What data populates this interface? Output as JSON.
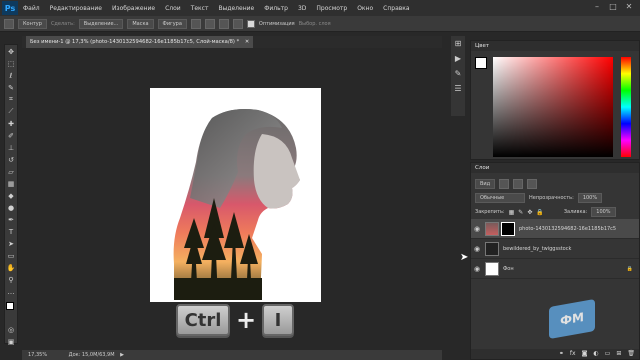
{
  "app": {
    "logo": "Ps"
  },
  "menu": [
    "Файл",
    "Редактирование",
    "Изображение",
    "Слои",
    "Текст",
    "Выделение",
    "Фильтр",
    "3D",
    "Просмотр",
    "Окно",
    "Справка"
  ],
  "options": {
    "mode": "Контур",
    "make_label": "Сделать:",
    "btn_selection": "Выделение...",
    "btn_mask": "Маска",
    "btn_shape": "Фигура",
    "optimize": "Оптимизация",
    "select_mask": "Выбор. слоя"
  },
  "document": {
    "tab_title": "Без имени-1 @ 17,3% (photo-1430132594682-16e1185b17c5, Слой-маска/8) *",
    "zoom": "17,35%",
    "doc_info": "Док: 15,0M/63,9M"
  },
  "shortcut": {
    "key1": "Ctrl",
    "plus": "+",
    "key2": "I"
  },
  "color_panel": {
    "title": "Цвет"
  },
  "layers_panel": {
    "title": "Слои",
    "filter_kind": "Вид",
    "blend_mode": "Обычные",
    "opacity_label": "Непрозрачность:",
    "opacity_value": "100%",
    "lock_label": "Закрепить:",
    "fill_label": "Заливка:",
    "fill_value": "100%",
    "layers": [
      {
        "name": "photo-1430132594682-16e1185b17c5"
      },
      {
        "name": "bewildered_by_twiggsstock"
      },
      {
        "name": "Фон"
      }
    ]
  },
  "watermark": {
    "text": "ФМ"
  },
  "colors": {
    "menubar": "#2f2f2f",
    "panel": "#353535",
    "canvas_bg": "#282828",
    "accent_blue": "#31a8ff"
  },
  "icons": {
    "tools": [
      "move-icon",
      "marquee-icon",
      "lasso-icon",
      "quick-select-icon",
      "crop-icon",
      "eyedropper-icon",
      "healing-icon",
      "brush-icon",
      "stamp-icon",
      "history-brush-icon",
      "eraser-icon",
      "gradient-icon",
      "blur-icon",
      "dodge-icon",
      "pen-icon",
      "type-icon",
      "path-select-icon",
      "rectangle-icon",
      "hand-icon",
      "zoom-icon"
    ]
  }
}
